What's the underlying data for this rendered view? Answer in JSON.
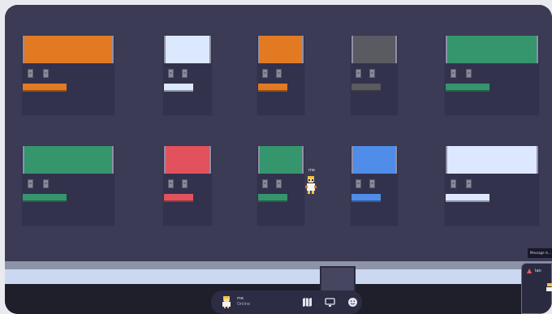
{
  "player": {
    "name_tag": "me",
    "status": "Online"
  },
  "rooms": [
    {
      "id": "r1",
      "color": "#e27a24"
    },
    {
      "id": "r2",
      "color": "#dce8ff"
    },
    {
      "id": "r3",
      "color": "#e27a24"
    },
    {
      "id": "r4",
      "color": "#5a5a62"
    },
    {
      "id": "r5",
      "color": "#35956d"
    },
    {
      "id": "r6",
      "color": "#35956d"
    },
    {
      "id": "r7",
      "color": "#e2525d"
    },
    {
      "id": "r8",
      "color": "#35956d"
    },
    {
      "id": "r9",
      "color": "#4f8de8"
    },
    {
      "id": "r10",
      "color": "#dce8ff"
    }
  ],
  "toolbar": {
    "icons": [
      "map-icon",
      "screen-share-icon",
      "emoji-icon"
    ]
  },
  "tooltip": {
    "text": "Message in..."
  },
  "side_panel": {
    "label": "Ian"
  },
  "colors": {
    "floor": "#3b3b56",
    "room": "#32324d",
    "toolbar": "#2c2c44",
    "light_strip": "#ccd8f2"
  }
}
